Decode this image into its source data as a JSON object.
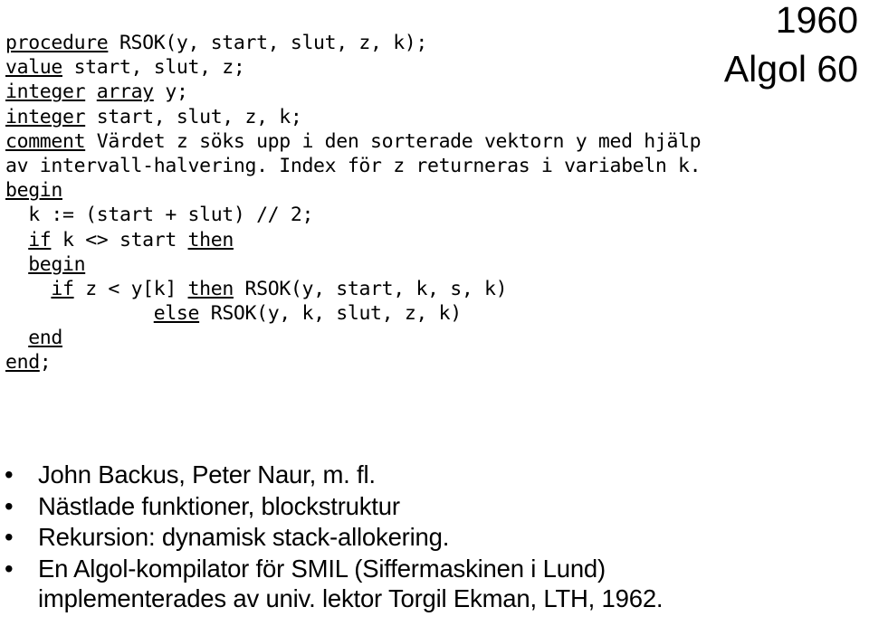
{
  "headings": {
    "year": "1960",
    "language": "Algol 60"
  },
  "code": {
    "language": "Algol 60",
    "lines": [
      [
        {
          "t": "procedure",
          "kw": true
        },
        {
          "t": " RSOK(y, start, slut, z, k);",
          "kw": false
        }
      ],
      [
        {
          "t": "value",
          "kw": true
        },
        {
          "t": " start, slut, z;",
          "kw": false
        }
      ],
      [
        {
          "t": "integer",
          "kw": true
        },
        {
          "t": " ",
          "kw": false
        },
        {
          "t": "array",
          "kw": true
        },
        {
          "t": " y;",
          "kw": false
        }
      ],
      [
        {
          "t": "integer",
          "kw": true
        },
        {
          "t": " start, slut, z, k;",
          "kw": false
        }
      ],
      [
        {
          "t": "comment",
          "kw": true
        },
        {
          "t": " Värdet z söks upp i den sorterade vektorn y med hjälp",
          "kw": false
        }
      ],
      [
        {
          "t": "av intervall-halvering. Index för z returneras i variabeln k.",
          "kw": false
        }
      ],
      [
        {
          "t": "begin",
          "kw": true
        }
      ],
      [
        {
          "t": "  k := (start + slut) // 2;",
          "kw": false
        }
      ],
      [
        {
          "t": "  ",
          "kw": false
        },
        {
          "t": "if",
          "kw": true
        },
        {
          "t": " k <> start ",
          "kw": false
        },
        {
          "t": "then",
          "kw": true
        }
      ],
      [
        {
          "t": "  ",
          "kw": false
        },
        {
          "t": "begin",
          "kw": true
        }
      ],
      [
        {
          "t": "    ",
          "kw": false
        },
        {
          "t": "if",
          "kw": true
        },
        {
          "t": " z < y[k] ",
          "kw": false
        },
        {
          "t": "then",
          "kw": true
        },
        {
          "t": " RSOK(y, start, k, s, k)",
          "kw": false
        }
      ],
      [
        {
          "t": "             ",
          "kw": false
        },
        {
          "t": "else",
          "kw": true
        },
        {
          "t": " RSOK(y, k, slut, z, k)",
          "kw": false
        }
      ],
      [
        {
          "t": "  ",
          "kw": false
        },
        {
          "t": "end",
          "kw": true
        }
      ],
      [
        {
          "t": "end",
          "kw": true
        },
        {
          "t": ";",
          "kw": false
        }
      ]
    ]
  },
  "bullets": [
    {
      "text": "John Backus, Peter Naur, m. fl.",
      "cont": ""
    },
    {
      "text": "Nästlade funktioner, blockstruktur",
      "cont": ""
    },
    {
      "text": "Rekursion: dynamisk stack-allokering.",
      "cont": ""
    },
    {
      "text": "En Algol-kompilator för SMIL (Siffermaskinen i Lund)",
      "cont": "implementerades av univ. lektor Torgil Ekman, LTH, 1962."
    }
  ],
  "bullet_marker": "•",
  "colors": {
    "background": "#ffffff",
    "text": "#000000"
  }
}
